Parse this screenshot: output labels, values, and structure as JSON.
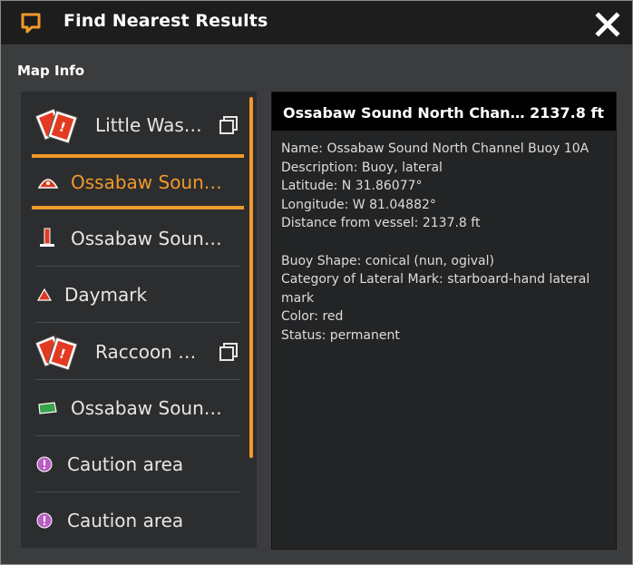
{
  "window": {
    "title": "Find Nearest Results"
  },
  "section_label": "Map Info",
  "list": [
    {
      "label": "Little Was…",
      "icon": "hazard-cards-icon",
      "extra_icon": "copy-icon"
    },
    {
      "label": "Ossabaw Soun…",
      "icon": "buoy-red-icon",
      "selected": true
    },
    {
      "label": "Ossabaw Soun…",
      "icon": "red-marker-post-icon"
    },
    {
      "label": "Daymark",
      "icon": "red-triangle-icon"
    },
    {
      "label": "Raccoon …",
      "icon": "hazard-cards-icon",
      "extra_icon": "copy-icon"
    },
    {
      "label": "Ossabaw Soun…",
      "icon": "buoy-green-icon"
    },
    {
      "label": "Caution area",
      "icon": "caution-icon"
    },
    {
      "label": "Caution area",
      "icon": "caution-icon"
    }
  ],
  "detail": {
    "title": "Ossabaw Sound North Chan… 2137.8 ft",
    "lines": [
      "Name: Ossabaw Sound North Channel Buoy 10A",
      "Description: Buoy, lateral",
      "Latitude: N 31.86077°",
      "Longitude: W 81.04882°",
      "Distance from vessel: 2137.8 ft",
      "",
      "Buoy Shape: conical (nun, ogival)",
      "Category of Lateral Mark: starboard-hand lateral",
      "mark",
      "Color: red",
      "Status: permanent"
    ]
  },
  "colors": {
    "accent": "#f09a2a",
    "title_bar": "#1d1d1e",
    "panel": "#3b3c3e"
  }
}
